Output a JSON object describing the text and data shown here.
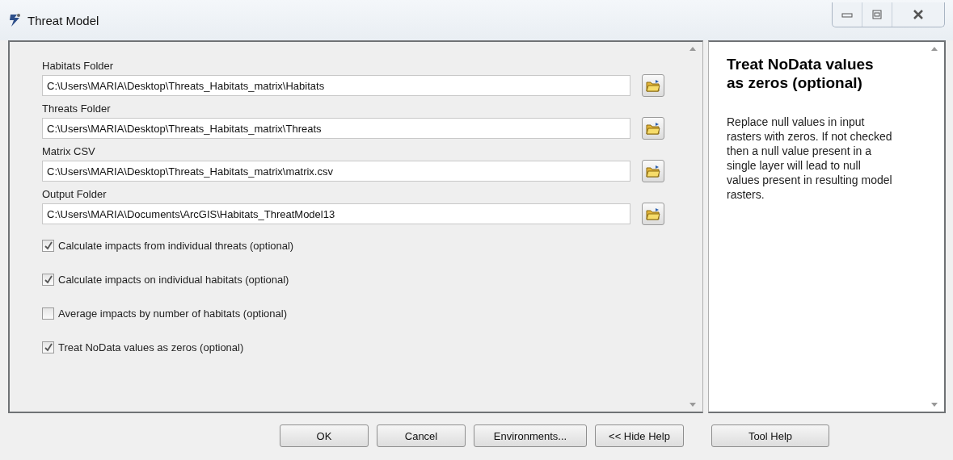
{
  "window": {
    "title": "Threat Model"
  },
  "fields": [
    {
      "label": "Habitats Folder",
      "value": "C:\\Users\\MARIA\\Desktop\\Threats_Habitats_matrix\\Habitats"
    },
    {
      "label": "Threats Folder",
      "value": "C:\\Users\\MARIA\\Desktop\\Threats_Habitats_matrix\\Threats"
    },
    {
      "label": "Matrix CSV",
      "value": "C:\\Users\\MARIA\\Desktop\\Threats_Habitats_matrix\\matrix.csv"
    },
    {
      "label": "Output Folder",
      "value": "C:\\Users\\MARIA\\Documents\\ArcGIS\\Habitats_ThreatModel13"
    }
  ],
  "options": [
    {
      "label": "Calculate impacts from individual threats (optional)",
      "checked": true
    },
    {
      "label": "Calculate impacts on individual habitats (optional)",
      "checked": true
    },
    {
      "label": "Average impacts by number of habitats (optional)",
      "checked": false
    },
    {
      "label": "Treat NoData values as zeros (optional)",
      "checked": true
    }
  ],
  "help": {
    "title": "Treat NoData values as zeros (optional)",
    "text": "Replace null values in input rasters with zeros. If not checked then a null value present in a single layer will lead to null values present in resulting model rasters."
  },
  "buttons": [
    {
      "label": "OK"
    },
    {
      "label": "Cancel"
    },
    {
      "label": "Environments..."
    },
    {
      "label": "<< Hide Help"
    },
    {
      "label": "Tool Help"
    }
  ]
}
